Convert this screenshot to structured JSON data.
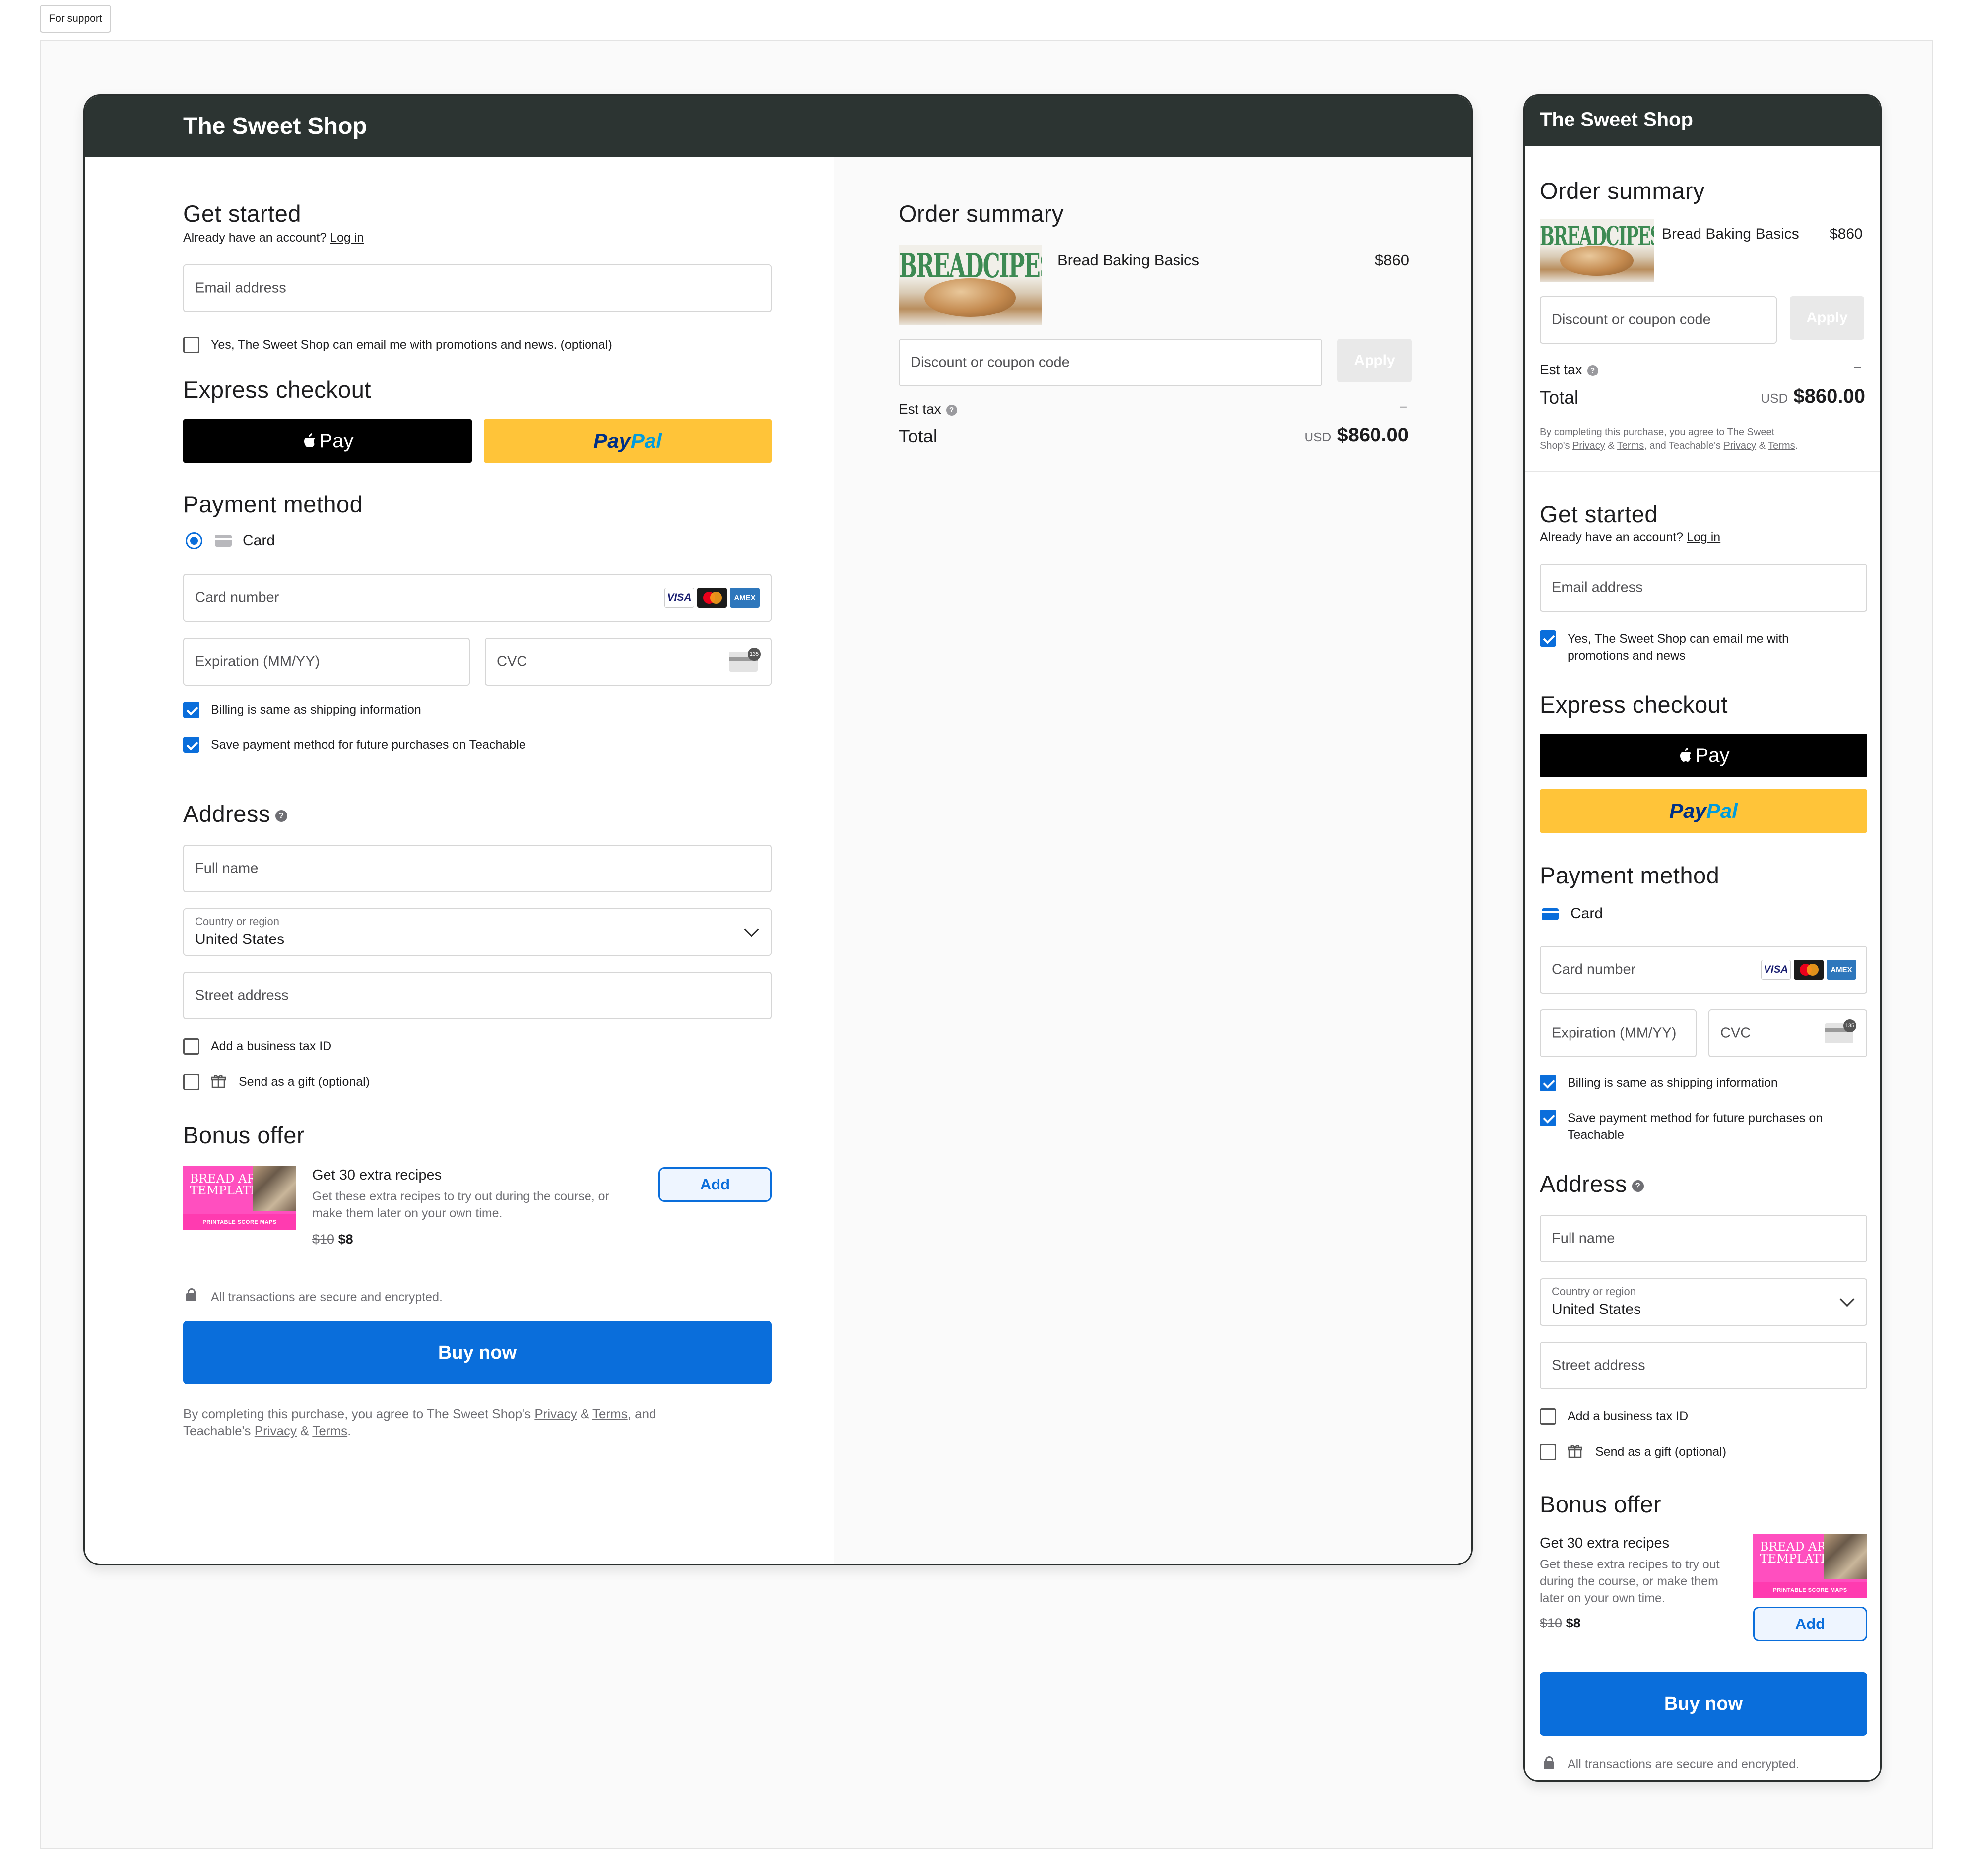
{
  "support_label": "For support",
  "shop_name": "The Sweet Shop",
  "get_started": {
    "title": "Get started",
    "account_prompt": "Already have an account?",
    "login_link": "Log in",
    "email_placeholder": "Email address",
    "promo_label_desktop": "Yes, The Sweet Shop can email me with promotions and news. (optional)",
    "promo_label_mobile_1": "Yes, The Sweet Shop can email me with",
    "promo_label_mobile_2": "promotions and news"
  },
  "express": {
    "title": "Express checkout",
    "apple_pay_label": "Pay",
    "paypal_part1": "Pay",
    "paypal_part2": "Pal"
  },
  "payment": {
    "title": "Payment method",
    "card_label": "Card",
    "card_number_placeholder": "Card number",
    "expiration_placeholder": "Expiration (MM/YY)",
    "cvc_placeholder": "CVC",
    "billing_same": "Billing is same as shipping information",
    "save_method": "Save payment method for future purchases on Teachable",
    "save_method_mobile_1": "Save payment method for future purchases on",
    "save_method_mobile_2": "Teachable",
    "brand_visa": "VISA",
    "brand_amex": "AMEX"
  },
  "address": {
    "title": "Address",
    "full_name_placeholder": "Full name",
    "country_label": "Country or region",
    "country_value": "United States",
    "street_placeholder": "Street address",
    "tax_id_label": "Add a business tax ID",
    "gift_label": "Send as a gift (optional)"
  },
  "bonus": {
    "title": "Bonus offer",
    "name": "Get 30 extra recipes",
    "desc_1": "Get these extra recipes to try out during the course, or",
    "desc_2": "make them later on your own time.",
    "desc_m1": "Get these extra recipes to try out",
    "desc_m2": "during the course, or make them",
    "desc_m3": "later on your own time.",
    "old_price": "$10",
    "new_price": "$8",
    "add_label": "Add",
    "image_line1": "BREAD ART",
    "image_line2": "TEMPLATES",
    "image_strip": "PRINTABLE SCORE MAPS"
  },
  "secure_note": "All transactions are secure and encrypted.",
  "buy_label": "Buy now",
  "terms": {
    "line1_prefix": "By completing this purchase, you agree to The Sweet Shop's",
    "privacy": "Privacy",
    "amp": "&",
    "terms": "Terms",
    "line1_suffix": ", and",
    "line2_prefix": "Teachable's",
    "period": ".",
    "m_line1": "By completing this purchase, you agree to The Sweet",
    "m_line2_prefix": "Shop's",
    "m_line2_mid": ", and Teachable's"
  },
  "order": {
    "title": "Order summary",
    "product_name": "Bread Baking Basics",
    "product_price": "$860",
    "product_image_text": "BREADCIPES",
    "coupon_placeholder": "Discount or coupon code",
    "apply_label": "Apply",
    "tax_label": "Est tax",
    "tax_value": "–",
    "total_label": "Total",
    "currency": "USD",
    "total_value": "$860.00"
  },
  "colors": {
    "header": "#2c3432",
    "primary": "#0a6edb",
    "paypal_bg": "#ffc439"
  },
  "icons": [
    "apple-icon",
    "card-icon",
    "visa-icon",
    "mastercard-icon",
    "amex-icon",
    "cvc-icon",
    "help-icon",
    "chevron-down-icon",
    "gift-icon",
    "lock-icon"
  ]
}
